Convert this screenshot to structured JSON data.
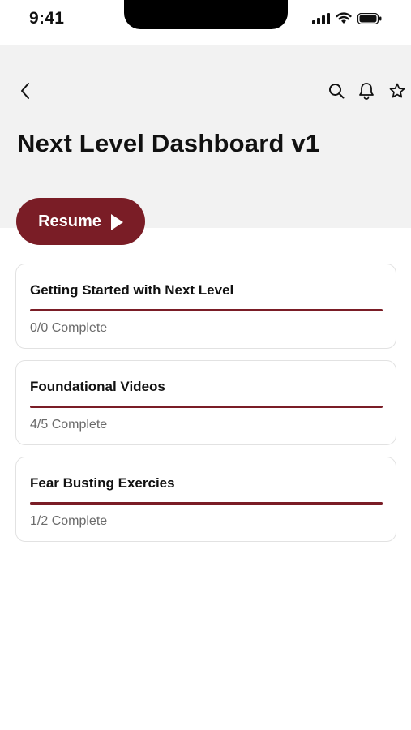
{
  "status_bar": {
    "time": "9:41",
    "icons": [
      "cellular-signal-icon",
      "wifi-icon",
      "battery-icon"
    ]
  },
  "header": {
    "title": "Next Level Dashboard v1",
    "icons": [
      "back-chevron-icon",
      "search-icon",
      "bell-icon",
      "star-icon"
    ]
  },
  "resume": {
    "label": "Resume",
    "icon": "play-icon"
  },
  "modules": [
    {
      "title": "Getting Started with Next Level",
      "status": "0/0 Complete",
      "progress": 1.0
    },
    {
      "title": "Foundational Videos",
      "status": "4/5 Complete",
      "progress": 1.0
    },
    {
      "title": "Fear Busting Exercies",
      "status": "1/2 Complete",
      "progress": 1.0
    }
  ],
  "colors": {
    "accent": "#7a1d26",
    "header_bg": "#f2f2f2",
    "card_border": "#e2e2e2",
    "muted_text": "#6b6b6b"
  }
}
